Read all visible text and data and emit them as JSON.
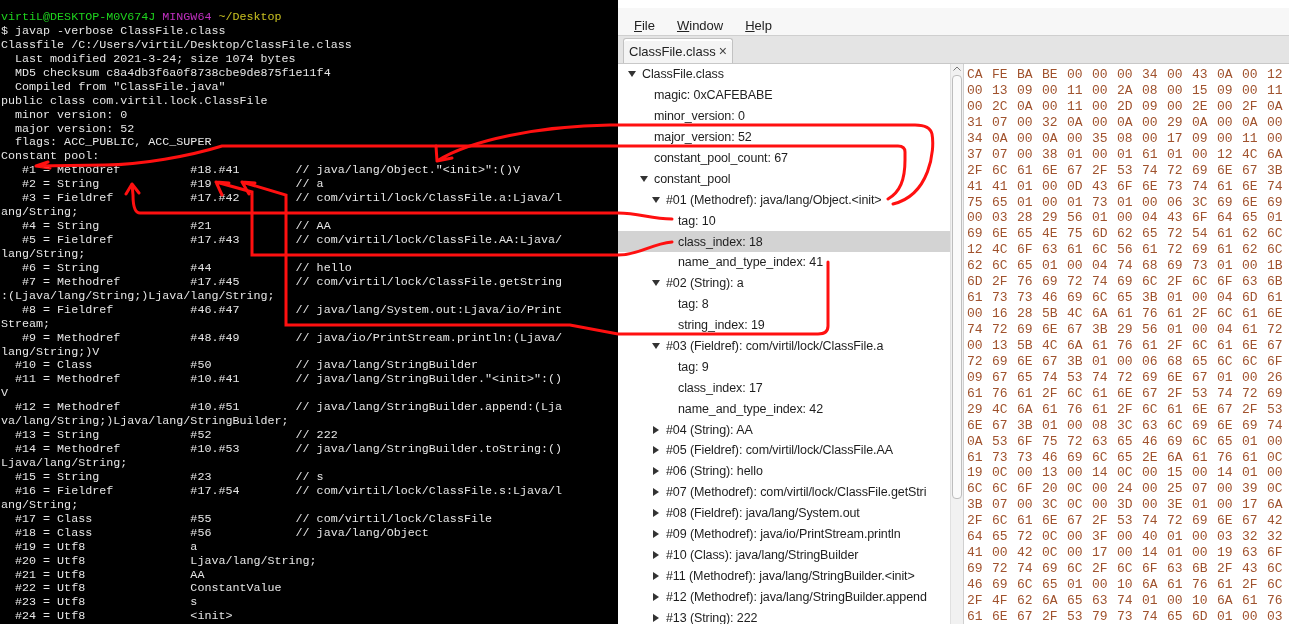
{
  "terminal": {
    "prompt": {
      "user_host": "virtiL@DESKTOP-M0V674J",
      "shell": "MINGW64",
      "path": "~/Desktop"
    },
    "lines": [
      "$ javap -verbose ClassFile.class",
      "Classfile /C:/Users/virtiL/Desktop/ClassFile.class",
      "  Last modified 2021-3-24; size 1074 bytes",
      "  MD5 checksum c8a4db3f6a0f8738cbe9de875f1e11f4",
      "  Compiled from \"ClassFile.java\"",
      "public class com.virtil.lock.ClassFile",
      "  minor version: 0",
      "  major version: 52",
      "  flags: ACC_PUBLIC, ACC_SUPER",
      "Constant pool:",
      "   #1 = Methodref          #18.#41        // java/lang/Object.\"<init>\":()V",
      "   #2 = String             #19            // a",
      "   #3 = Fieldref           #17.#42        // com/virtil/lock/ClassFile.a:Ljava/l",
      "ang/String;",
      "   #4 = String             #21            // AA",
      "   #5 = Fieldref           #17.#43        // com/virtil/lock/ClassFile.AA:Ljava/",
      "lang/String;",
      "   #6 = String             #44            // hello",
      "   #7 = Methodref          #17.#45        // com/virtil/lock/ClassFile.getString",
      ":(Ljava/lang/String;)Ljava/lang/String;",
      "   #8 = Fieldref           #46.#47        // java/lang/System.out:Ljava/io/Print",
      "Stream;",
      "   #9 = Methodref          #48.#49        // java/io/PrintStream.println:(Ljava/",
      "lang/String;)V",
      "  #10 = Class              #50            // java/lang/StringBuilder",
      "  #11 = Methodref          #10.#41        // java/lang/StringBuilder.\"<init>\":()",
      "V",
      "  #12 = Methodref          #10.#51        // java/lang/StringBuilder.append:(Lja",
      "va/lang/String;)Ljava/lang/StringBuilder;",
      "  #13 = String             #52            // 222",
      "  #14 = Methodref          #10.#53        // java/lang/StringBuilder.toString:()",
      "Ljava/lang/String;",
      "  #15 = String             #23            // s",
      "  #16 = Fieldref           #17.#54        // com/virtil/lock/ClassFile.s:Ljava/l",
      "ang/String;",
      "  #17 = Class              #55            // com/virtil/lock/ClassFile",
      "  #18 = Class              #56            // java/lang/Object",
      "  #19 = Utf8               a",
      "  #20 = Utf8               Ljava/lang/String;",
      "  #21 = Utf8               AA",
      "  #22 = Utf8               ConstantValue",
      "  #23 = Utf8               s",
      "  #24 = Utf8               <init>"
    ]
  },
  "menu_bar": [
    {
      "label": "File"
    },
    {
      "label": "Window"
    },
    {
      "label": "Help"
    }
  ],
  "tabs": [
    {
      "label": "ClassFile.class",
      "close": "×",
      "selected": true
    }
  ],
  "tree": [
    {
      "label": "ClassFile.class",
      "expanded": true,
      "selected": false,
      "children": [
        {
          "label": "magic: 0xCAFEBABE",
          "selected": false
        },
        {
          "label": "minor_version: 0",
          "selected": false
        },
        {
          "label": "major_version: 52",
          "selected": false
        },
        {
          "label": "constant_pool_count: 67",
          "selected": false
        },
        {
          "label": "constant_pool",
          "expanded": true,
          "selected": false,
          "children": [
            {
              "label": "#01 (Methodref): java/lang/Object.<init>",
              "expanded": true,
              "selected": false,
              "children": [
                {
                  "label": "tag: 10",
                  "selected": false
                },
                {
                  "label": "class_index: 18",
                  "selected": true
                },
                {
                  "label": "name_and_type_index: 41",
                  "selected": false
                }
              ]
            },
            {
              "label": "#02 (String): a",
              "expanded": true,
              "selected": false,
              "children": [
                {
                  "label": "tag: 8",
                  "selected": false
                },
                {
                  "label": "string_index: 19",
                  "selected": false
                }
              ]
            },
            {
              "label": "#03 (Fieldref): com/virtil/lock/ClassFile.a",
              "expanded": true,
              "selected": false,
              "children": [
                {
                  "label": "tag: 9",
                  "selected": false
                },
                {
                  "label": "class_index: 17",
                  "selected": false
                },
                {
                  "label": "name_and_type_index: 42",
                  "selected": false
                }
              ]
            },
            {
              "label": "#04 (String): AA",
              "expanded": false,
              "selected": false
            },
            {
              "label": "#05 (Fieldref): com/virtil/lock/ClassFile.AA",
              "expanded": false,
              "selected": false
            },
            {
              "label": "#06 (String): hello",
              "expanded": false,
              "selected": false
            },
            {
              "label": "#07 (Methodref): com/virtil/lock/ClassFile.getStri",
              "expanded": false,
              "selected": false
            },
            {
              "label": "#08 (Fieldref): java/lang/System.out",
              "expanded": false,
              "selected": false
            },
            {
              "label": "#09 (Methodref): java/io/PrintStream.println",
              "expanded": false,
              "selected": false
            },
            {
              "label": "#10 (Class): java/lang/StringBuilder",
              "expanded": false,
              "selected": false
            },
            {
              "label": "#11 (Methodref): java/lang/StringBuilder.<init>",
              "expanded": false,
              "selected": false
            },
            {
              "label": "#12 (Methodref): java/lang/StringBuilder.append",
              "expanded": false,
              "selected": false
            },
            {
              "label": "#13 (String): 222",
              "expanded": false,
              "selected": false
            }
          ]
        }
      ]
    }
  ],
  "hex_rows": [
    "CA FE BA BE 00 00 00 34 00 43 0A 00 12",
    "00 13 09 00 11 00 2A 08 00 15 09 00 11",
    "00 2C 0A 00 11 00 2D 09 00 2E 00 2F 0A",
    "31 07 00 32 0A 00 0A 00 29 0A 00 0A 00",
    "34 0A 00 0A 00 35 08 00 17 09 00 11 00",
    "37 07 00 38 01 00 01 61 01 00 12 4C 6A",
    "2F 6C 61 6E 67 2F 53 74 72 69 6E 67 3B",
    "41 41 01 00 0D 43 6F 6E 73 74 61 6E 74",
    "75 65 01 00 01 73 01 00 06 3C 69 6E 69",
    "00 03 28 29 56 01 00 04 43 6F 64 65 01",
    "69 6E 65 4E 75 6D 62 65 72 54 61 62 6C",
    "12 4C 6F 63 61 6C 56 61 72 69 61 62 6C",
    "62 6C 65 01 00 04 74 68 69 73 01 00 1B",
    "6D 2F 76 69 72 74 69 6C 2F 6C 6F 63 6B",
    "61 73 73 46 69 6C 65 3B 01 00 04 6D 61",
    "00 16 28 5B 4C 6A 61 76 61 2F 6C 61 6E",
    "74 72 69 6E 67 3B 29 56 01 00 04 61 72",
    "00 13 5B 4C 6A 61 76 61 2F 6C 61 6E 67",
    "72 69 6E 67 3B 01 00 06 68 65 6C 6C 6F",
    "09 67 65 74 53 74 72 69 6E 67 01 00 26",
    "61 76 61 2F 6C 61 6E 67 2F 53 74 72 69",
    "29 4C 6A 61 76 61 2F 6C 61 6E 67 2F 53",
    "6E 67 3B 01 00 08 3C 63 6C 69 6E 69 74",
    "0A 53 6F 75 72 63 65 46 69 6C 65 01 00",
    "61 73 73 46 69 6C 65 2E 6A 61 76 61 0C",
    "19 0C 00 13 00 14 0C 00 15 00 14 01 00",
    "6C 6C 6F 20 0C 00 24 00 25 07 00 39 0C",
    "3B 07 00 3C 0C 00 3D 00 3E 01 00 17 6A",
    "2F 6C 61 6E 67 2F 53 74 72 69 6E 67 42",
    "64 65 72 0C 00 3F 00 40 01 00 03 32 32",
    "41 00 42 0C 00 17 00 14 01 00 19 63 6F",
    "69 72 74 69 6C 2F 6C 6F 63 6B 2F 43 6C",
    "46 69 6C 65 01 00 10 6A 61 76 61 2F 6C",
    "2F 4F 62 6A 65 63 74 01 00 10 6A 61 76",
    "61 6E 67 2F 53 79 73 74 65 6D 01 00 03"
  ]
}
